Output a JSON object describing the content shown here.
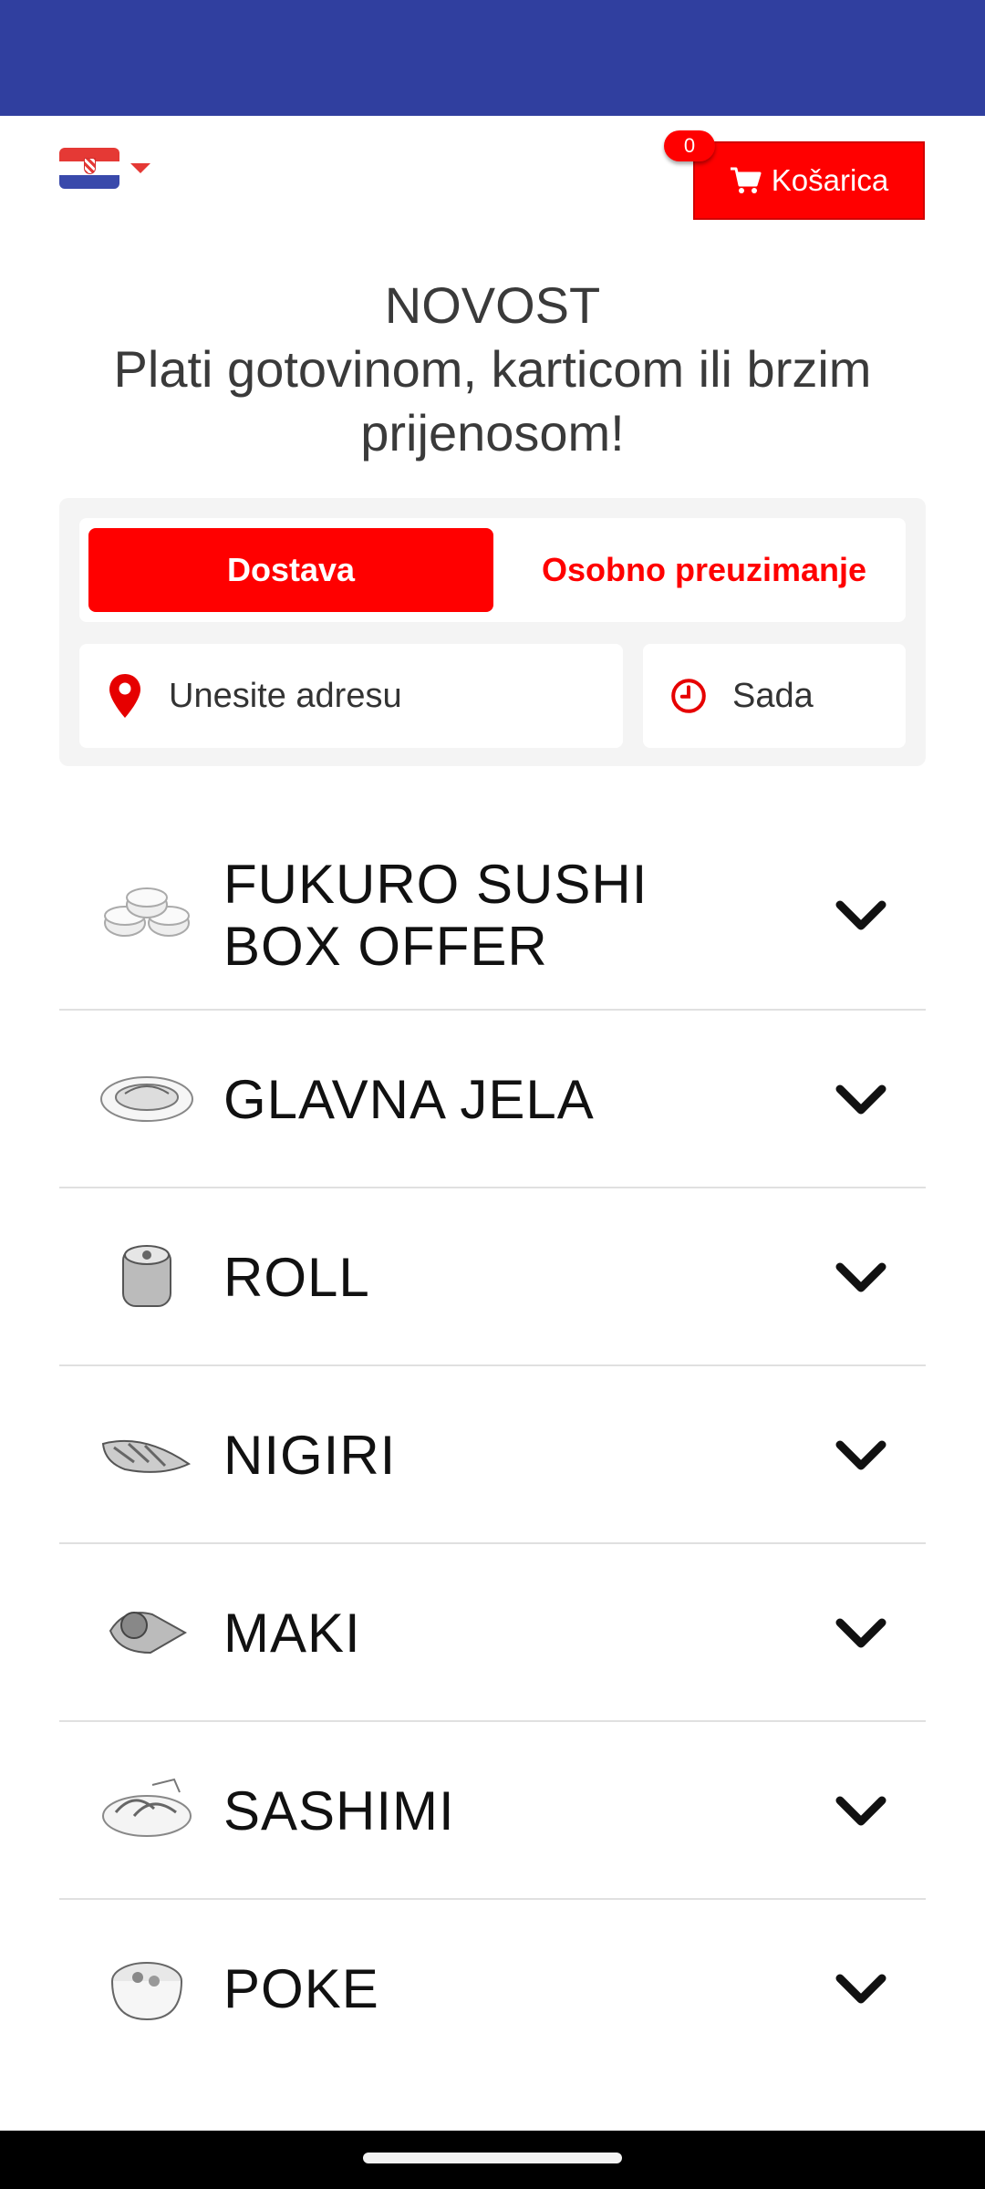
{
  "header": {
    "language_flag": "croatia-flag",
    "cart_label": "Košarica",
    "cart_count": "0"
  },
  "promo": {
    "title": "NOVOST",
    "text": "Plati gotovinom, karticom ili brzim prijenosom!"
  },
  "order": {
    "tabs": [
      {
        "label": "Dostava",
        "active": true
      },
      {
        "label": "Osobno preuzimanje",
        "active": false
      }
    ],
    "address_placeholder": "Unesite adresu",
    "address_icon": "map-marker-icon",
    "time_value": "Sada",
    "time_icon": "clock-icon"
  },
  "menu": {
    "categories": [
      {
        "label": "FUKURO SUSHI BOX OFFER",
        "icon": "sushi-rolls-icon"
      },
      {
        "label": "GLAVNA JELA",
        "icon": "plate-icon"
      },
      {
        "label": "ROLL",
        "icon": "roll-icon"
      },
      {
        "label": "NIGIRI",
        "icon": "nigiri-icon"
      },
      {
        "label": "MAKI",
        "icon": "maki-cone-icon"
      },
      {
        "label": "SASHIMI",
        "icon": "sashimi-icon"
      },
      {
        "label": "POKE",
        "icon": "poke-bowl-icon"
      }
    ]
  },
  "colors": {
    "status_bar": "#303f9f",
    "accent": "#ff0000",
    "nav_bar": "#000000"
  }
}
